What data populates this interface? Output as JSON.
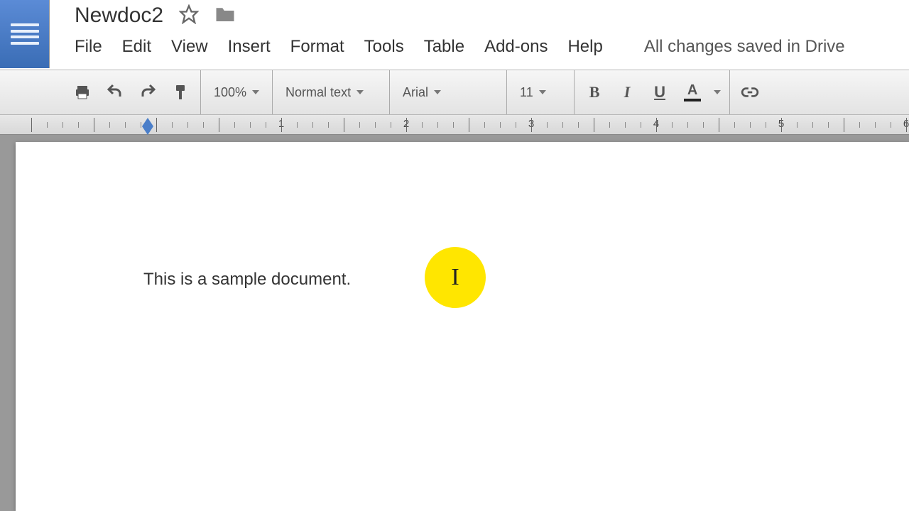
{
  "header": {
    "doc_title": "Newdoc2",
    "save_status": "All changes saved in Drive"
  },
  "menu": {
    "file": "File",
    "edit": "Edit",
    "view": "View",
    "insert": "Insert",
    "format": "Format",
    "tools": "Tools",
    "table": "Table",
    "addons": "Add-ons",
    "help": "Help"
  },
  "toolbar": {
    "zoom": "100%",
    "style": "Normal text",
    "font": "Arial",
    "size": "11",
    "bold": "B",
    "italic": "I",
    "underline": "U",
    "textcolor": "A"
  },
  "ruler": {
    "labels": [
      "1",
      "2",
      "3",
      "4",
      "5",
      "6"
    ]
  },
  "document": {
    "body_text": "This is a sample document."
  },
  "cursor": {
    "glyph": "I"
  }
}
